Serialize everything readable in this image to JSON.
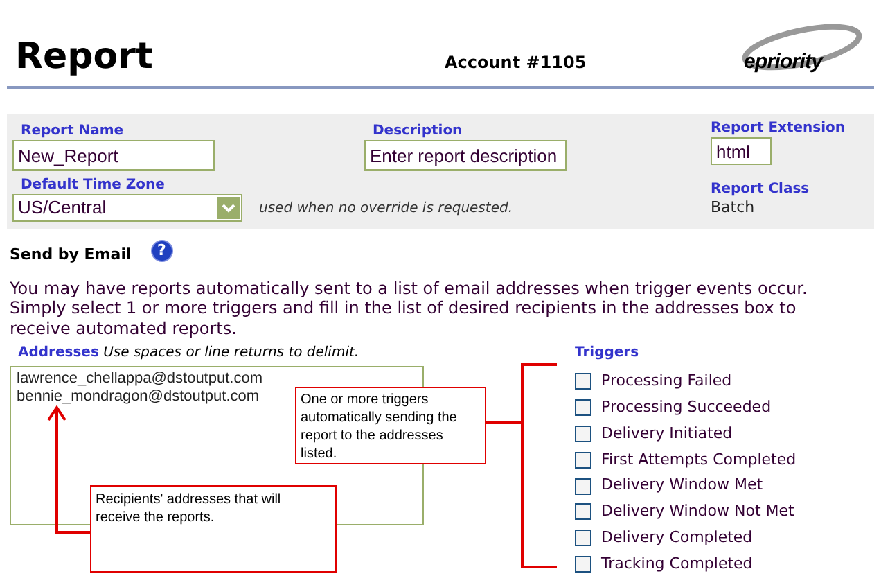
{
  "header": {
    "title": "Report",
    "account": "Account #1105",
    "logo": "epriority"
  },
  "form": {
    "report_name": {
      "label": "Report Name",
      "value": "New_Report"
    },
    "description": {
      "label": "Description",
      "placeholder": "Enter report description"
    },
    "report_extension": {
      "label": "Report Extension",
      "value": "html"
    },
    "time_zone": {
      "label": "Default Time Zone",
      "value": "US/Central",
      "note": "used when no override is requested."
    },
    "report_class": {
      "label": "Report Class",
      "value": "Batch"
    }
  },
  "email": {
    "heading": "Send by Email",
    "help": "?",
    "intro": "You may have reports automatically sent to a list of email addresses when trigger events occur. Simply select 1 or more triggers and fill in the list of desired recipients in the addresses box to receive automated reports.",
    "addresses_label": "Addresses",
    "addresses_hint": "Use spaces or line returns to delimit.",
    "addresses": [
      "lawrence_chellappa@dstoutput.com",
      "bennie_mondragon@dstoutput.com"
    ],
    "triggers_label": "Triggers",
    "triggers": [
      {
        "label": "Processing Failed",
        "checked": false
      },
      {
        "label": "Processing Succeeded",
        "checked": false
      },
      {
        "label": "Delivery Initiated",
        "checked": false
      },
      {
        "label": "First Attempts Completed",
        "checked": false
      },
      {
        "label": "Delivery Window Met",
        "checked": false
      },
      {
        "label": "Delivery Window Not Met",
        "checked": false
      },
      {
        "label": "Delivery Completed",
        "checked": false
      },
      {
        "label": "Tracking Completed",
        "checked": false
      }
    ],
    "callouts": [
      {
        "text": "One or more triggers automatically sending the report to the addresses listed."
      },
      {
        "text": "Recipients' addresses that will receive the reports."
      }
    ]
  }
}
